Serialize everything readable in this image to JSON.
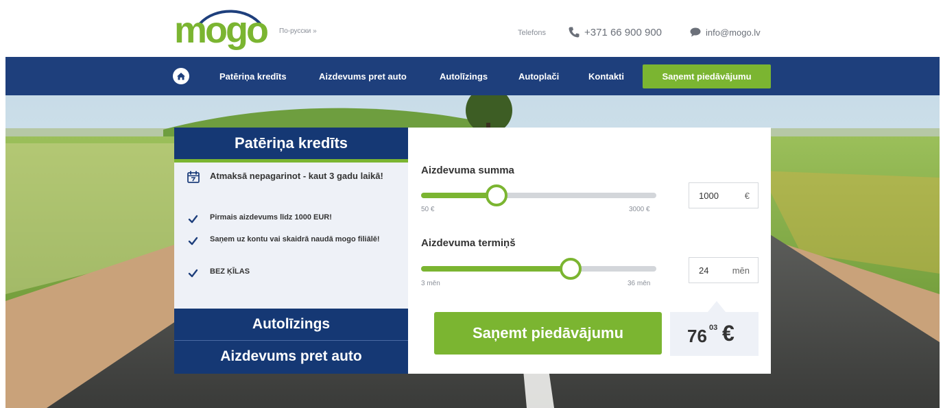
{
  "header": {
    "logo_text": "mogo",
    "language_link": "По-русски »",
    "phone_label": "Telefons",
    "phone_number": "+371 66 900 900",
    "email": "info@mogo.lv"
  },
  "nav": {
    "items": [
      {
        "label": "Patēriņa kredīts"
      },
      {
        "label": "Aizdevums pret auto"
      },
      {
        "label": "Autolīzings"
      },
      {
        "label": "Autoplači"
      },
      {
        "label": "Kontakti"
      }
    ],
    "cta_label": "Saņemt piedāvājumu"
  },
  "left_panel": {
    "title": "Patēriņa kredīts",
    "features": [
      {
        "icon": "calendar-icon",
        "text": "Atmaksā nepagarinot - kaut 3 gadu laikā!"
      },
      {
        "icon": "checkmark-icon",
        "text": "Pirmais aizdevums līdz 1000 EUR!"
      },
      {
        "icon": "checkmark-icon",
        "text": "Saņem uz kontu vai skaidrā naudā mogo filiālē!"
      },
      {
        "icon": "checkmark-icon",
        "text": "BEZ ĶĪLAS"
      }
    ],
    "tabs": [
      {
        "label": "Autolīzings"
      },
      {
        "label": "Aizdevums pret auto"
      }
    ]
  },
  "calculator": {
    "amount": {
      "label": "Aizdevuma summa",
      "min_label": "50 €",
      "max_label": "3000 €",
      "min": 50,
      "max": 3000,
      "value": 1000,
      "value_text": "1000",
      "unit": "€"
    },
    "term": {
      "label": "Aizdevuma termiņš",
      "min_label": "3 mēn",
      "max_label": "36 mēn",
      "min": 3,
      "max": 36,
      "value": 24,
      "value_text": "24",
      "unit": "mēn"
    },
    "cta_label": "Saņemt piedāvājumu",
    "monthly_payment": {
      "main": "76",
      "cents": "03",
      "currency": "€"
    }
  },
  "colors": {
    "brand_green": "#7bb531",
    "brand_blue": "#1e3f7c",
    "panel_blue": "#153874"
  }
}
